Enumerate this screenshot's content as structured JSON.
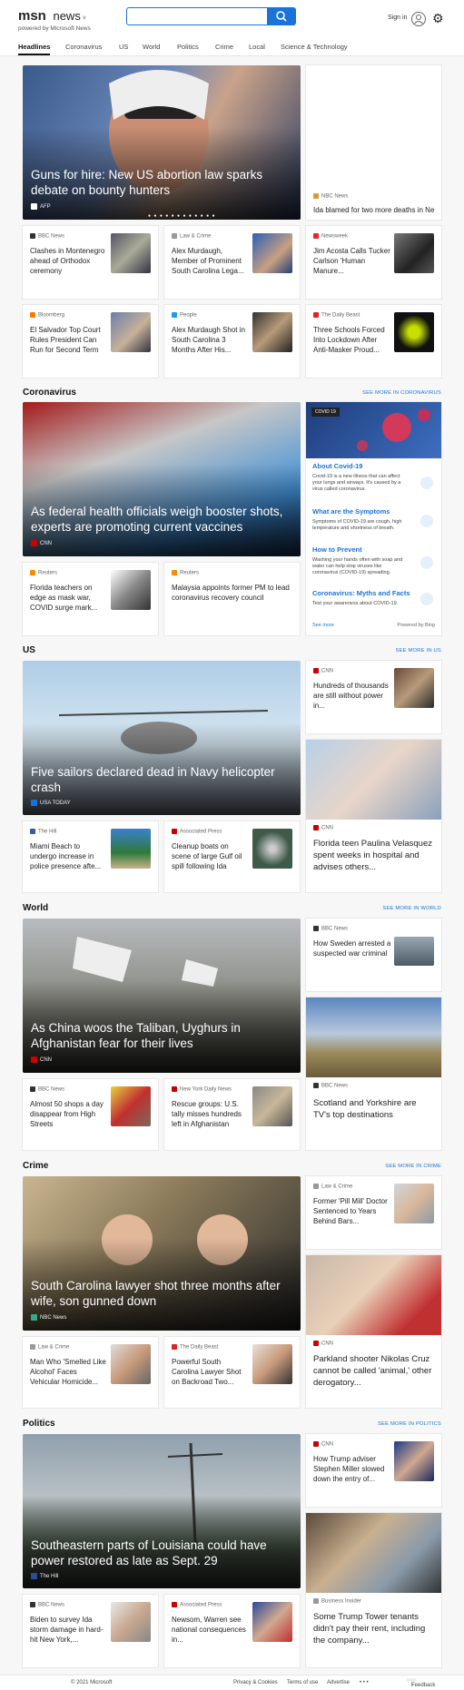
{
  "header": {
    "logo_brand": "msn",
    "logo_news": "news",
    "powered": "powered by Microsoft News",
    "search_placeholder": "",
    "signin": "Sign in"
  },
  "nav": {
    "tabs": [
      "Headlines",
      "Coronavirus",
      "US",
      "World",
      "Politics",
      "Crime",
      "Local",
      "Science & Technology"
    ]
  },
  "headlines": {
    "hero": {
      "title": "Guns for hire: New US abortion law sparks debate on bounty hunters",
      "source": "AFP"
    },
    "side_top": {
      "source": "NBC News",
      "title": "Ida blamed for two more deaths in New..."
    },
    "row1": [
      {
        "source": "BBC News",
        "title": "Clashes in Montenegro ahead of Orthodox ceremony"
      },
      {
        "source": "Law & Crime",
        "title": "Alex Murdaugh, Member of Prominent South Carolina Lega..."
      },
      {
        "source": "Newsweek",
        "title": "Jim Acosta Calls Tucker Carlson 'Human Manure..."
      }
    ],
    "row2": [
      {
        "source": "Bloomberg",
        "title": "El Salvador Top Court Rules President Can Run for Second Term"
      },
      {
        "source": "People",
        "title": "Alex Murdaugh Shot in South Carolina 3 Months After His..."
      },
      {
        "source": "The Daily Beast",
        "title": "Three Schools Forced Into Lockdown After Anti-Masker Proud..."
      }
    ]
  },
  "coronavirus": {
    "section": "Coronavirus",
    "see_more": "SEE MORE IN CORONAVIRUS",
    "hero": {
      "title": "As federal health officials weigh booster shots, experts are promoting current vaccines",
      "source": "CNN"
    },
    "row": [
      {
        "source": "Reuters",
        "title": "Florida teachers on edge as mask war, COVID surge mark..."
      },
      {
        "source": "Reuters",
        "title": "Malaysia appoints former PM to lead coronavirus recovery council"
      }
    ],
    "widget": {
      "badge": "COVID 19",
      "items": [
        {
          "title": "About Covid-19",
          "text": "Covid-19 is a new illness that can affect your lungs and airways. It's caused by a virus called coronavirus."
        },
        {
          "title": "What are the Symptoms",
          "text": "Symptoms of COVID-19 are cough, high temperature and shortness of breath."
        },
        {
          "title": "How to Prevent",
          "text": "Washing your hands often with soap and water can help stop viruses like coronavirus (COVID-19) spreading."
        },
        {
          "title": "Coronavirus: Myths and Facts",
          "text": "Test your awareness about COVID-19."
        }
      ],
      "see_more": "See more",
      "powered": "Powered by Bing"
    }
  },
  "us": {
    "section": "US",
    "see_more": "SEE MORE IN US",
    "hero": {
      "title": "Five sailors declared dead in Navy helicopter crash",
      "source": "USA TODAY"
    },
    "side_top": {
      "source": "CNN",
      "title": "Hundreds of thousands are still without power in..."
    },
    "side_big": {
      "source": "CNN",
      "title": "Florida teen Paulina Velasquez spent weeks in hospital and advises others..."
    },
    "row": [
      {
        "source": "The Hill",
        "title": "Miami Beach to undergo increase in police presence afte..."
      },
      {
        "source": "Associated Press",
        "title": "Cleanup boats on scene of large Gulf oil spill following Ida"
      }
    ]
  },
  "world": {
    "section": "World",
    "see_more": "SEE MORE IN WORLD",
    "hero": {
      "title": "As China woos the Taliban, Uyghurs in Afghanistan fear for their lives",
      "source": "CNN"
    },
    "side_top": {
      "source": "BBC News",
      "title": "How Sweden arrested a suspected war criminal"
    },
    "side_big": {
      "source": "BBC News",
      "title": "Scotland and Yorkshire are TV's top destinations"
    },
    "row": [
      {
        "source": "BBC News",
        "title": "Almost 50 shops a day disappear from High Streets"
      },
      {
        "source": "New York Daily News",
        "title": "Rescue groups: U.S. tally misses hundreds left in Afghanistan"
      }
    ]
  },
  "crime": {
    "section": "Crime",
    "see_more": "SEE MORE IN CRIME",
    "hero": {
      "title": "South Carolina lawyer shot three months after wife, son gunned down",
      "source": "NBC News"
    },
    "side_top": {
      "source": "Law & Crime",
      "title": "Former 'Pill Mill' Doctor Sentenced to Years Behind Bars..."
    },
    "side_big": {
      "source": "CNN",
      "title": "Parkland shooter Nikolas Cruz cannot be called 'animal,' other derogatory..."
    },
    "row": [
      {
        "source": "Law & Crime",
        "title": "Man Who 'Smelled Like Alcohol' Faces Vehicular Homicide..."
      },
      {
        "source": "The Daily Beast",
        "title": "Powerful South Carolina Lawyer Shot on Backroad Two..."
      }
    ]
  },
  "politics": {
    "section": "Politics",
    "see_more": "SEE MORE IN POLITICS",
    "hero": {
      "title": "Southeastern parts of Louisiana could have power restored as late as Sept. 29",
      "source": "The Hill"
    },
    "side_top": {
      "source": "CNN",
      "title": "How Trump adviser Stephen Miller slowed down the entry of..."
    },
    "side_big": {
      "source": "Business Insider",
      "title": "Some Trump Tower tenants didn't pay their rent, including the company..."
    },
    "row": [
      {
        "source": "BBC News",
        "title": "Biden to survey Ida storm damage in hard-hit New York,..."
      },
      {
        "source": "Associated Press",
        "title": "Newsom, Warren see national consequences in..."
      }
    ]
  },
  "footer": {
    "copyright": "© 2021 Microsoft",
    "links": [
      "Privacy & Cookies",
      "Terms of use",
      "Advertise"
    ],
    "more": "• • •",
    "feedback": "Feedback"
  }
}
